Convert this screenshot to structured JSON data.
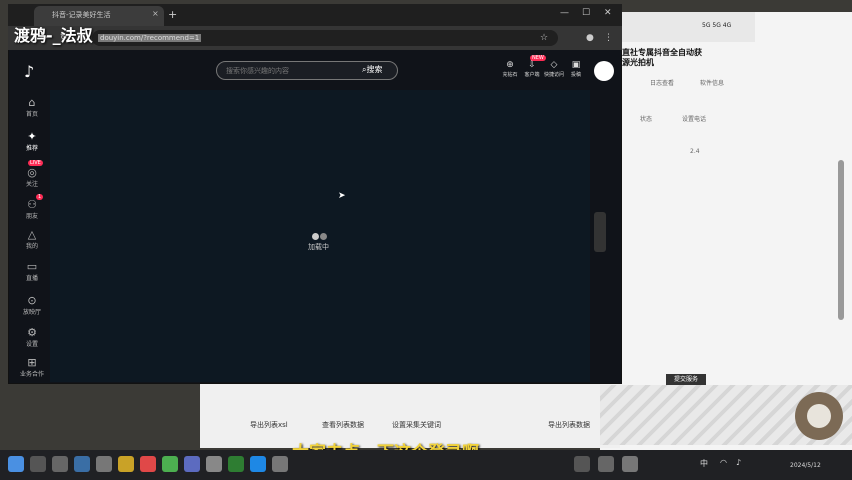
{
  "overlay_text": "渡鸦-_法叔",
  "subtitle": "大家去点一下这个登录啊",
  "browser": {
    "tab_title": "抖音-记录美好生活",
    "new_tab": "+",
    "close": "×",
    "url_text": "douyin.com/?recommend=1",
    "win_min": "—",
    "win_max": "☐",
    "win_close": "✕"
  },
  "tiktok": {
    "logo": "♪",
    "search_placeholder": "搜索你感兴趣的内容",
    "search_button": "搜索",
    "top_icons": [
      {
        "icon": "⊕",
        "label": "充钻石"
      },
      {
        "icon": "⇩",
        "label": "客户端"
      },
      {
        "icon": "◇",
        "label": "快捷访问"
      },
      {
        "icon": "▣",
        "label": "投稿"
      }
    ],
    "new_badge": "NEW",
    "nav": [
      {
        "icon": "⌂",
        "label": "首页"
      },
      {
        "icon": "✦",
        "label": "推荐"
      },
      {
        "icon": "◎",
        "label": "关注"
      },
      {
        "icon": "⚇",
        "label": "朋友"
      },
      {
        "icon": "△",
        "label": "我的"
      },
      {
        "icon": "▭",
        "label": "直播"
      },
      {
        "icon": "⊙",
        "label": "放映厅"
      },
      {
        "icon": "⚙",
        "label": "设置"
      },
      {
        "icon": "⊞",
        "label": "业务合作"
      }
    ],
    "live_badge": "LIVE",
    "friends_badge": "1",
    "loading_text": "加载中"
  },
  "right_app": {
    "status": "5G 5G 4G",
    "title_line1": "直社专属抖音全自动获",
    "title_line2": "源光拍机",
    "labels": [
      "日志查看",
      "软件信息",
      "状态",
      "设置电话",
      "2.4"
    ],
    "button": "提交服务"
  },
  "bottom_app": {
    "links": [
      "导出列表xsl",
      "查看列表数据",
      "设置采集关键词",
      "导出列表数据"
    ]
  },
  "taskbar": {
    "sys_text": "中",
    "date": "2024/5/12"
  },
  "colors": {
    "page_bg": "#101319",
    "accent": "#fe2c55",
    "subtitle": "#f1d23a"
  }
}
